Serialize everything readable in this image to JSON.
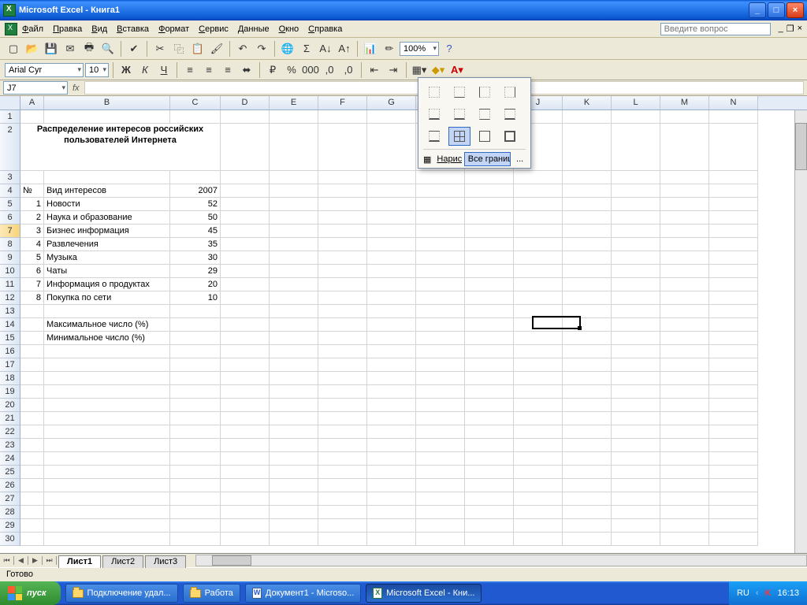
{
  "title": "Microsoft Excel - Книга1",
  "menu": [
    "Файл",
    "Правка",
    "Вид",
    "Вставка",
    "Формат",
    "Сервис",
    "Данные",
    "Окно",
    "Справка"
  ],
  "help_placeholder": "Введите вопрос",
  "font": {
    "name": "Arial Cyr",
    "size": "10"
  },
  "zoom": "100%",
  "namebox": "J7",
  "columns": [
    "A",
    "B",
    "C",
    "D",
    "E",
    "F",
    "G",
    "H",
    "I",
    "J",
    "K",
    "L",
    "M",
    "N"
  ],
  "heading": "Распределение интересов российских пользователей Интернета",
  "header_row": {
    "A": "№",
    "B": "Вид интересов",
    "C": "2007"
  },
  "rows": [
    {
      "n": "1",
      "b": "Новости",
      "c": "52"
    },
    {
      "n": "2",
      "b": "Наука и образование",
      "c": "50"
    },
    {
      "n": "3",
      "b": "Бизнес информация",
      "c": "45"
    },
    {
      "n": "4",
      "b": "Развлечения",
      "c": "35"
    },
    {
      "n": "5",
      "b": "Музыка",
      "c": "30"
    },
    {
      "n": "6",
      "b": "Чаты",
      "c": "29"
    },
    {
      "n": "7",
      "b": "Информация о продуктах",
      "c": "20"
    },
    {
      "n": "8",
      "b": "Покупка по сети",
      "c": "10"
    }
  ],
  "summary": [
    "Максимальное число (%)",
    "Минимальное число (%)"
  ],
  "sheets": [
    "Лист1",
    "Лист2",
    "Лист3"
  ],
  "status": "Готово",
  "borders_popup": {
    "draw": "Нарисов",
    "tooltip": "Все границы",
    "dots": "..."
  },
  "taskbar": {
    "start": "пуск",
    "items": [
      "Подключение удал...",
      "Работа",
      "Документ1 - Microso...",
      "Microsoft Excel - Кни..."
    ],
    "lang": "RU",
    "time": "16:13"
  }
}
